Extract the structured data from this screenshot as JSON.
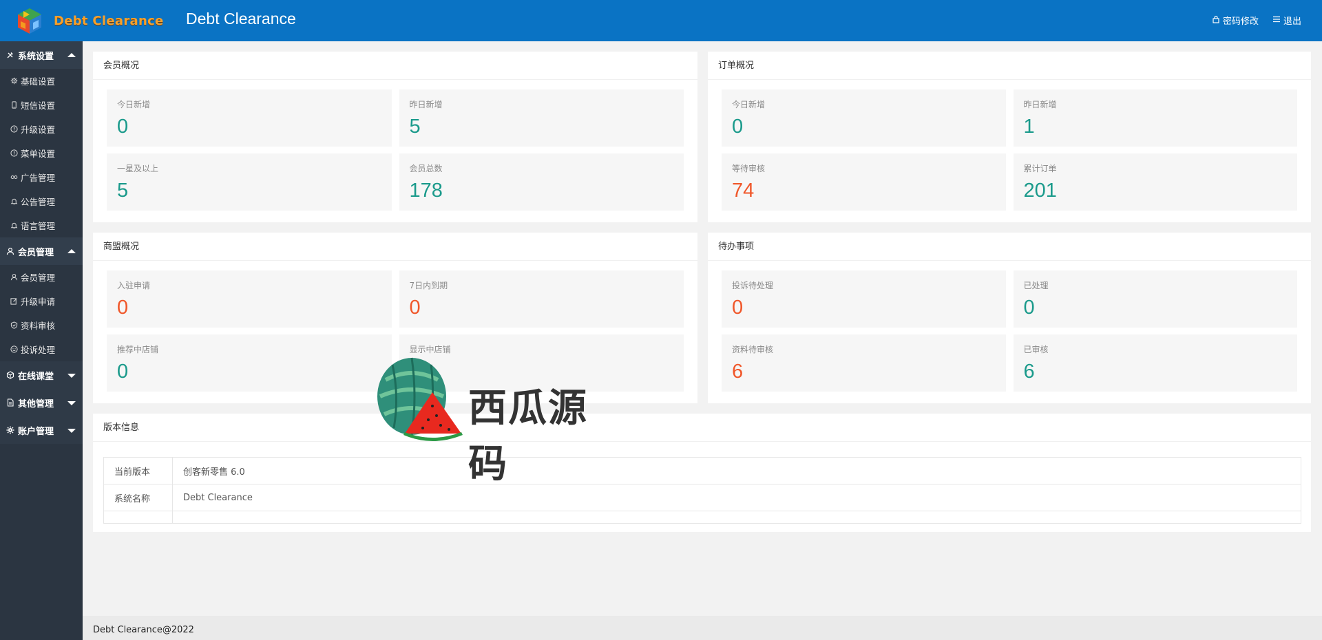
{
  "header": {
    "logo_text": "Debt Clearance",
    "title": "Debt Clearance",
    "links": {
      "password": "密码修改",
      "logout": "退出"
    }
  },
  "sidebar": {
    "groups": [
      {
        "label": "系统设置",
        "icon": "tools-icon",
        "expanded": true,
        "items": [
          {
            "label": "基础设置",
            "icon": "gear-icon"
          },
          {
            "label": "短信设置",
            "icon": "phone-icon"
          },
          {
            "label": "升级设置",
            "icon": "info-circle-icon"
          },
          {
            "label": "菜单设置",
            "icon": "info-circle-icon"
          },
          {
            "label": "广告管理",
            "icon": "link-icon"
          },
          {
            "label": "公告管理",
            "icon": "bell-icon"
          },
          {
            "label": "语言管理",
            "icon": "bell-icon"
          }
        ]
      },
      {
        "label": "会员管理",
        "icon": "user-icon",
        "expanded": true,
        "items": [
          {
            "label": "会员管理",
            "icon": "user-icon"
          },
          {
            "label": "升级申请",
            "icon": "edit-icon"
          },
          {
            "label": "资料审核",
            "icon": "shield-icon"
          },
          {
            "label": "投诉处理",
            "icon": "smile-icon"
          }
        ]
      },
      {
        "label": "在线课堂",
        "icon": "cube-icon",
        "expanded": false,
        "items": []
      },
      {
        "label": "其他管理",
        "icon": "doc-icon",
        "expanded": false,
        "items": []
      },
      {
        "label": "账户管理",
        "icon": "gear-icon",
        "expanded": false,
        "items": []
      }
    ]
  },
  "member_overview": {
    "title": "会员概况",
    "stats": [
      {
        "label": "今日新增",
        "value": "0",
        "color": "teal"
      },
      {
        "label": "昨日新增",
        "value": "5",
        "color": "teal"
      },
      {
        "label": "一星及以上",
        "value": "5",
        "color": "teal"
      },
      {
        "label": "会员总数",
        "value": "178",
        "color": "teal"
      }
    ]
  },
  "order_overview": {
    "title": "订单概况",
    "stats": [
      {
        "label": "今日新增",
        "value": "0",
        "color": "teal"
      },
      {
        "label": "昨日新增",
        "value": "1",
        "color": "teal"
      },
      {
        "label": "等待审核",
        "value": "74",
        "color": "orange"
      },
      {
        "label": "累计订单",
        "value": "201",
        "color": "teal"
      }
    ]
  },
  "merchant_overview": {
    "title": "商盟概况",
    "stats": [
      {
        "label": "入驻申请",
        "value": "0",
        "color": "orange"
      },
      {
        "label": "7日内到期",
        "value": "0",
        "color": "orange"
      },
      {
        "label": "推荐中店铺",
        "value": "0",
        "color": "teal"
      },
      {
        "label": "显示中店铺",
        "value": "",
        "color": "teal"
      }
    ]
  },
  "todo": {
    "title": "待办事项",
    "stats": [
      {
        "label": "投诉待处理",
        "value": "0",
        "color": "orange"
      },
      {
        "label": "已处理",
        "value": "0",
        "color": "teal"
      },
      {
        "label": "资料待审核",
        "value": "6",
        "color": "orange"
      },
      {
        "label": "已审核",
        "value": "6",
        "color": "teal"
      }
    ]
  },
  "version": {
    "title": "版本信息",
    "rows": [
      {
        "key": "当前版本",
        "value": "创客新零售 6.0"
      },
      {
        "key": "系统名称",
        "value": "Debt Clearance"
      }
    ]
  },
  "footer": {
    "text": "Debt Clearance@2022"
  },
  "watermark": {
    "text": "西瓜源码"
  },
  "colors": {
    "header": "#0a73c4",
    "sidebar": "#2b3541",
    "teal": "#1a9a8b",
    "orange": "#f0572a"
  }
}
